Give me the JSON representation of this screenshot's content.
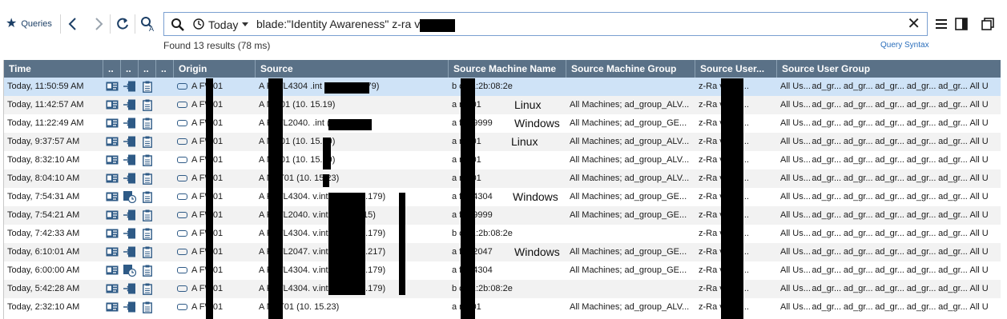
{
  "toolbar": {
    "queries_label": "Queries",
    "today_label": "Today",
    "query_text": "blade:\"Identity Awareness\" z-ra           voreanu",
    "found_text": "Found 13 results (78 ms)",
    "query_syntax_label": "Query Syntax"
  },
  "columns": [
    "Time",
    "..",
    "..",
    "..",
    "..",
    "Origin",
    "Source",
    "Source Machine Name",
    "Source Machine Group",
    "Source User...",
    "Source User Group"
  ],
  "rows": [
    {
      "time": "Today, 11:50:59 AM",
      "origin": "A      FW01",
      "source": "A       F-WL4304            .int (10.  7.21.179)",
      "machine": "b     c:d1:2b:08:2e",
      "group": "",
      "user": "z-Ra          vorea...",
      "usergroups": [
        "All Us...",
        "ad_gr...",
        "ad_gr...",
        "ad_gr...",
        "ad_gr...",
        "ad_gr...",
        "All U"
      ],
      "alt": false,
      "sel": true,
      "icon": "plain"
    },
    {
      "time": "Today, 11:42:57 AM",
      "origin": "A      FW01",
      "source": "A       NM01 (10.   15.19)",
      "machine": "a      nm01",
      "group": "All Machines; ad_group_ALV...",
      "user": "z-Ra          vorea...",
      "usergroups": [
        "All Us...",
        "ad_gr...",
        "ad_gr...",
        "ad_gr...",
        "ad_gr...",
        "ad_gr...",
        "All U"
      ],
      "alt": true,
      "sel": false,
      "icon": "plain"
    },
    {
      "time": "Today, 11:22:49 AM",
      "origin": "A      FW01",
      "source": "A       F-WL2040.            .int (10.   .18.15)",
      "machine": "a      f-wl9999",
      "group": "All Machines; ad_group_GE...",
      "user": "z-Ra          vorea...",
      "usergroups": [
        "All Us...",
        "ad_gr...",
        "ad_gr...",
        "ad_gr...",
        "ad_gr...",
        "ad_gr...",
        "All U"
      ],
      "alt": false,
      "sel": false,
      "icon": "plain"
    },
    {
      "time": "Today, 9:37:57 AM",
      "origin": "A      FW01",
      "source": "A       NM01 (10.   15.19)",
      "machine": "a      nm01",
      "group": "All Machines; ad_group_ALV...",
      "user": "z-Ra          vorea...",
      "usergroups": [
        "All Us...",
        "ad_gr...",
        "ad_gr...",
        "ad_gr...",
        "ad_gr...",
        "ad_gr...",
        "All U"
      ],
      "alt": true,
      "sel": false,
      "icon": "plain"
    },
    {
      "time": "Today, 8:32:10 AM",
      "origin": "A      FW01",
      "source": "A       NM01 (10.   15.19)",
      "machine": "a      nm01",
      "group": "All Machines; ad_group_ALV...",
      "user": "z-Ra          vorea...",
      "usergroups": [
        "All Us...",
        "ad_gr...",
        "ad_gr...",
        "ad_gr...",
        "ad_gr...",
        "ad_gr...",
        "All U"
      ],
      "alt": false,
      "sel": false,
      "icon": "plain"
    },
    {
      "time": "Today, 8:04:10 AM",
      "origin": "A      FW01",
      "source": "A       NET01 (10.   15.23)",
      "machine": "a      net01",
      "group": "All Machines; ad_group_ALV...",
      "user": "z-Ra          vorea...",
      "usergroups": [
        "All Us...",
        "ad_gr...",
        "ad_gr...",
        "ad_gr...",
        "ad_gr...",
        "ad_gr...",
        "All U"
      ],
      "alt": true,
      "sel": false,
      "icon": "plain"
    },
    {
      "time": "Today, 7:54:31 AM",
      "origin": "A      FW01",
      "source": "A       F-WL4304.            v.int (10.  7.21.179)",
      "machine": "a      f-wl4304",
      "group": "All Machines; ad_group_GE...",
      "user": "z-Ra          vorea...",
      "usergroups": [
        "All Us...",
        "ad_gr...",
        "ad_gr...",
        "ad_gr...",
        "ad_gr...",
        "ad_gr...",
        "All U"
      ],
      "alt": false,
      "sel": false,
      "icon": "clock"
    },
    {
      "time": "Today, 7:54:21 AM",
      "origin": "A      FW01",
      "source": "A       F-WL2040.            v.int (10.   .18.15)",
      "machine": "a      f-wl9999",
      "group": "All Machines; ad_group_GE...",
      "user": "z-Ra          vorea...",
      "usergroups": [
        "All Us...",
        "ad_gr...",
        "ad_gr...",
        "ad_gr...",
        "ad_gr...",
        "ad_gr...",
        "All U"
      ],
      "alt": true,
      "sel": false,
      "icon": "plain"
    },
    {
      "time": "Today, 7:42:33 AM",
      "origin": "A      FW01",
      "source": "A       F-WL4304.            v.int (10.  7.21.179)",
      "machine": "b     c:d1:2b:08:2e",
      "group": "",
      "user": "z-Ra          vorea...",
      "usergroups": [
        "All Us...",
        "ad_gr...",
        "ad_gr...",
        "ad_gr...",
        "ad_gr...",
        "ad_gr...",
        "All U"
      ],
      "alt": false,
      "sel": false,
      "icon": "plain"
    },
    {
      "time": "Today, 6:10:01 AM",
      "origin": "A      FW01",
      "source": "A       F-WL2047.            v.int (10.  7.35.217)",
      "machine": "a      f-wl2047",
      "group": "All Machines; ad_group_GE...",
      "user": "z-Ra          vorea...",
      "usergroups": [
        "All Us...",
        "ad_gr...",
        "ad_gr...",
        "ad_gr...",
        "ad_gr...",
        "ad_gr...",
        "All U"
      ],
      "alt": true,
      "sel": false,
      "icon": "plain"
    },
    {
      "time": "Today, 6:00:00 AM",
      "origin": "A      FW01",
      "source": "A       F-WL4304.            v.int (10.  7.21.179)",
      "machine": "a      f-wl4304",
      "group": "All Machines; ad_group_GE...",
      "user": "z-Ra          vorea...",
      "usergroups": [
        "All Us...",
        "ad_gr...",
        "ad_gr...",
        "ad_gr...",
        "ad_gr...",
        "ad_gr...",
        "All U"
      ],
      "alt": false,
      "sel": false,
      "icon": "clock"
    },
    {
      "time": "Today, 5:42:28 AM",
      "origin": "A      FW01",
      "source": "A       F-WL4304.            v.int (10.  7.21.179)",
      "machine": "b     c:d1:2b:08:2e",
      "group": "",
      "user": "z-Ra          vorea...",
      "usergroups": [
        "All Us...",
        "ad_gr...",
        "ad_gr...",
        "ad_gr...",
        "ad_gr...",
        "ad_gr...",
        "All U"
      ],
      "alt": true,
      "sel": false,
      "icon": "plain"
    },
    {
      "time": "Today, 2:32:10 AM",
      "origin": "A      FW01",
      "source": "A       NET01 (10.   15.23)",
      "machine": "a      net01",
      "group": "All Machines; ad_group_ALV...",
      "user": "z-Ra          vorea...",
      "usergroups": [
        "All Us...",
        "ad_gr...",
        "ad_gr...",
        "ad_gr...",
        "ad_gr...",
        "ad_gr...",
        "All U"
      ],
      "alt": false,
      "sel": false,
      "icon": "plain"
    }
  ],
  "annotations": [
    {
      "text": "Linux",
      "row": 1
    },
    {
      "text": "Windows",
      "row": 2
    },
    {
      "text": "Linux",
      "row": 3
    },
    {
      "text": "Windows",
      "row": 6
    },
    {
      "text": "Windows",
      "row": 9
    }
  ],
  "colors": {
    "header_bg": "#5a7187",
    "selected_row": "#cfe3f7",
    "alt_row": "#f2f2f2",
    "accent": "#2a6ebb"
  }
}
